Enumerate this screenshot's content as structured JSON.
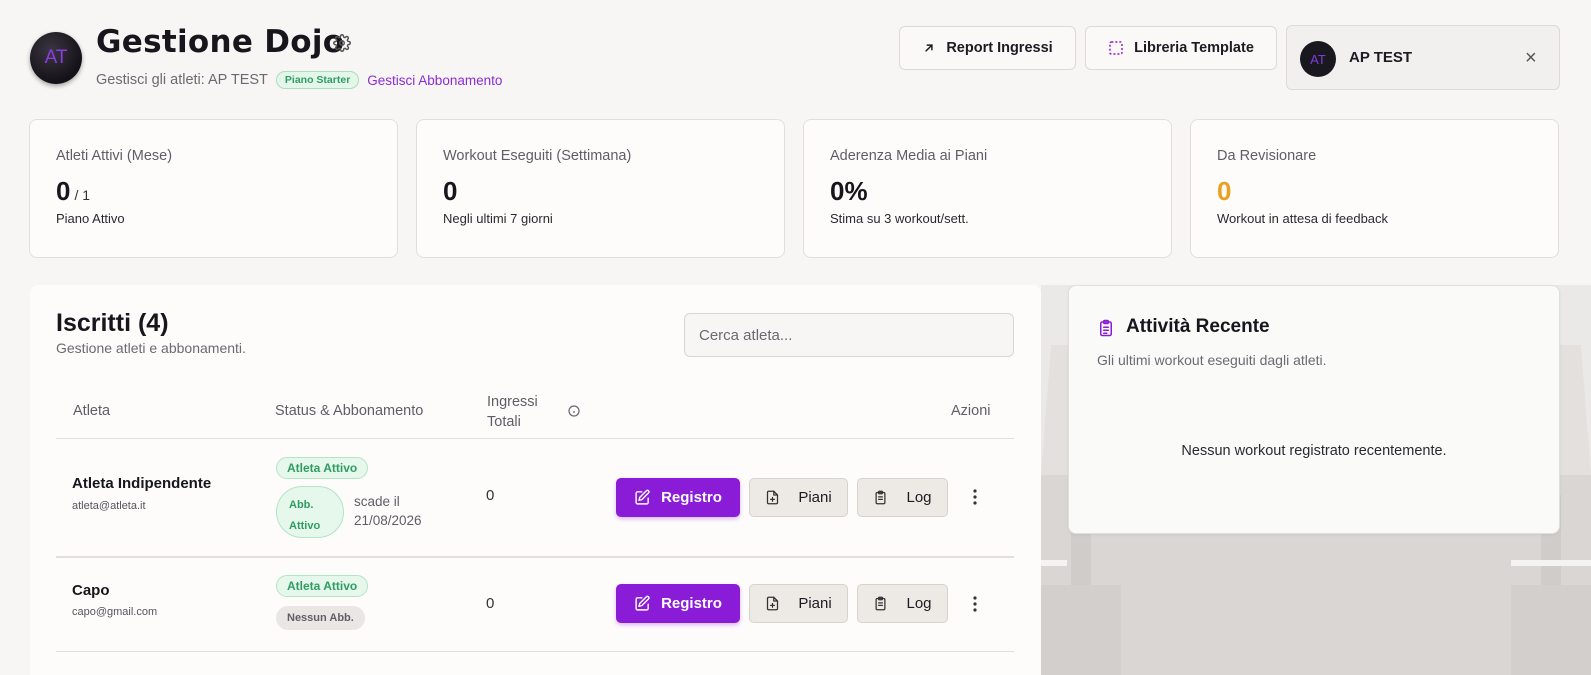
{
  "header": {
    "avatar_initials": "AT",
    "title": "Gestione Dojo",
    "subtitle_text": "Gestisci gli atleti: AP TEST",
    "plan_badge": "Piano Starter",
    "manage_link": "Gestisci Abbonamento",
    "report_button": "Report Ingressi",
    "library_button": "Libreria Template",
    "user": {
      "initials": "AT",
      "name": "AP TEST",
      "close_symbol": "×"
    }
  },
  "stats": [
    {
      "label": "Atleti Attivi (Mese)",
      "value": "0",
      "suffix": "/ 1",
      "note": "Piano Attivo"
    },
    {
      "label": "Workout Eseguiti (Settimana)",
      "value": "0",
      "note": "Negli ultimi 7 giorni"
    },
    {
      "label": "Aderenza Media ai Piani",
      "value": "0%",
      "note": "Stima su 3 workout/sett."
    },
    {
      "label": "Da Revisionare",
      "value": "0",
      "note": "Workout in attesa di feedback",
      "value_color": "#eba020"
    }
  ],
  "members": {
    "title": "Iscritti (4)",
    "subtitle": "Gestione atleti e abbonamenti.",
    "search_placeholder": "Cerca atleta...",
    "columns": {
      "athlete": "Atleta",
      "status": "Status & Abbonamento",
      "entries_line1": "Ingressi",
      "entries_line2": "Totali",
      "actions": "Azioni"
    },
    "rows": [
      {
        "name": "Atleta Indipendente",
        "email": "atleta@atleta.it",
        "status": "Atleta Attivo",
        "subscription_line1": "Abb.",
        "subscription_line2": "Attivo",
        "expiry_line1": "scade il",
        "expiry_line2": "21/08/2026",
        "entries": "0",
        "btn_registro": "Registro",
        "btn_piani": "Piani",
        "btn_log": "Log"
      },
      {
        "name": "Capo",
        "email": "capo@gmail.com",
        "status": "Atleta Attivo",
        "subscription": "Nessun Abb.",
        "entries": "0",
        "btn_registro": "Registro",
        "btn_piani": "Piani",
        "btn_log": "Log"
      }
    ]
  },
  "activity": {
    "title": "Attività Recente",
    "subtitle": "Gli ultimi workout eseguiti dagli atleti.",
    "empty": "Nessun workout registrato recentemente."
  },
  "colors": {
    "accent": "#8a1bd6",
    "success": "#2f9d62",
    "warning": "#eba020"
  },
  "icons": [
    "gear-icon",
    "arrow-up-right-icon",
    "dashed-square-icon",
    "close-icon",
    "info-icon",
    "edit-icon",
    "file-plus-icon",
    "clipboard-icon",
    "more-vertical-icon"
  ]
}
